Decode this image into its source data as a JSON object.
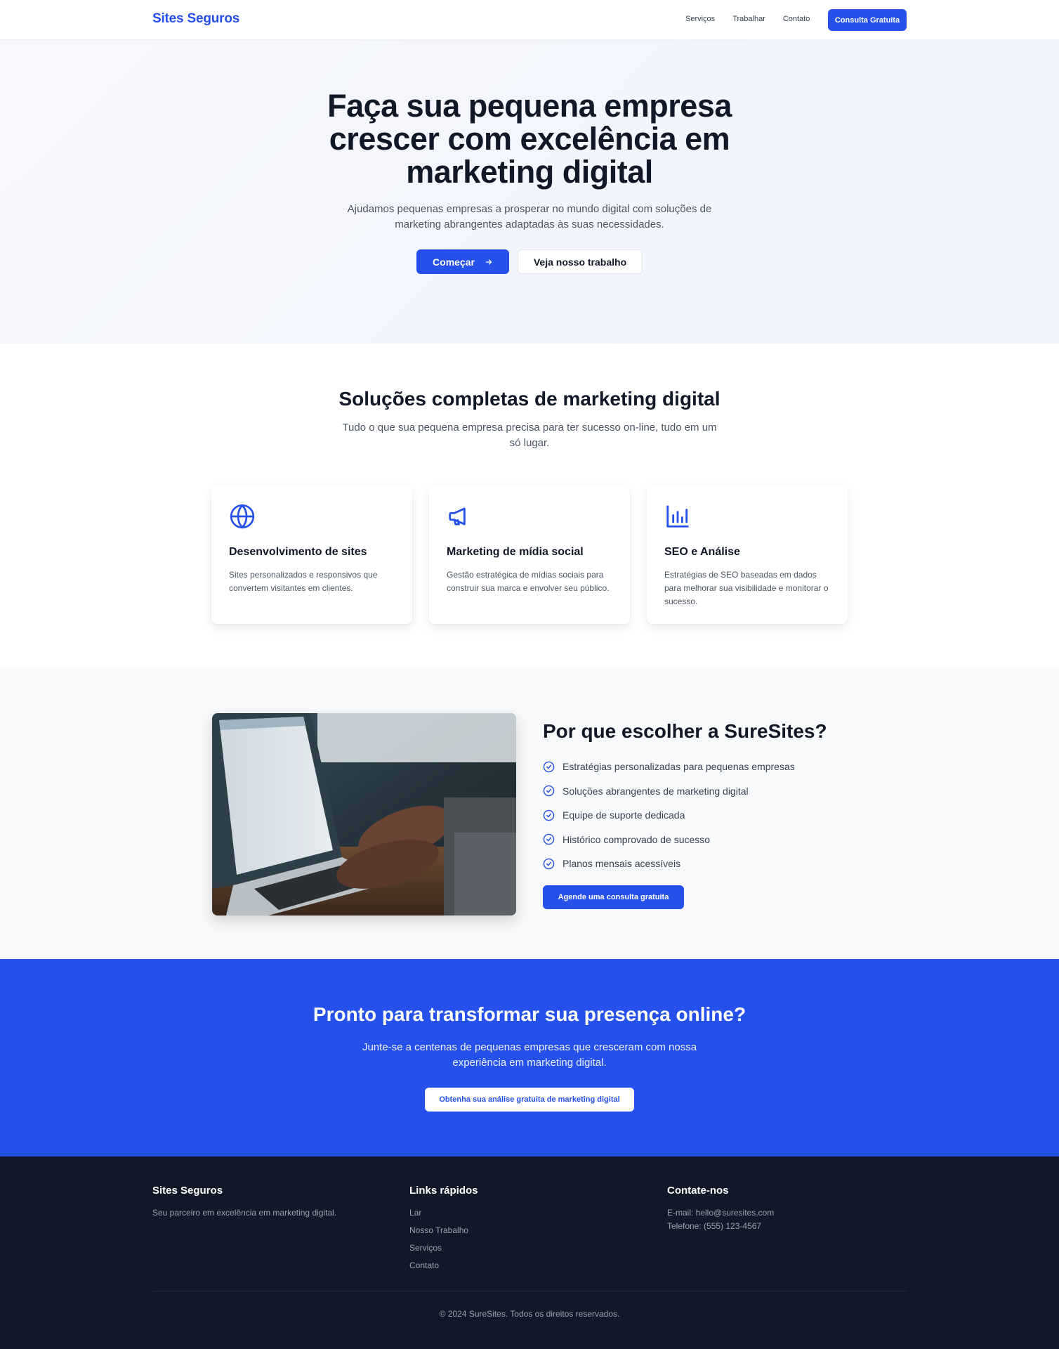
{
  "header": {
    "brand": "Sites Seguros",
    "nav": [
      "Serviços",
      "Trabalhar",
      "Contato"
    ],
    "cta": "Consulta Gratuita"
  },
  "hero": {
    "title": "Faça sua pequena empresa crescer com excelência em marketing digital",
    "subtitle": "Ajudamos pequenas empresas a prosperar no mundo digital com soluções de marketing abrangentes adaptadas às suas necessidades.",
    "primary_button": "Começar",
    "secondary_button": "Veja nosso trabalho"
  },
  "services": {
    "title": "Soluções completas de marketing digital",
    "subtitle": "Tudo o que sua pequena empresa precisa para ter sucesso on-line, tudo em um só lugar.",
    "cards": [
      {
        "icon": "globe-icon",
        "title": "Desenvolvimento de sites",
        "text": "Sites personalizados e responsivos que convertem visitantes em clientes."
      },
      {
        "icon": "megaphone-icon",
        "title": "Marketing de mídia social",
        "text": "Gestão estratégica de mídias sociais para construir sua marca e envolver seu público."
      },
      {
        "icon": "bar-chart-icon",
        "title": "SEO e Análise",
        "text": "Estratégias de SEO baseadas em dados para melhorar sua visibilidade e monitorar o sucesso."
      }
    ]
  },
  "why": {
    "title": "Por que escolher a SureSites?",
    "items": [
      "Estratégias personalizadas para pequenas empresas",
      "Soluções abrangentes de marketing digital",
      "Equipe de suporte dedicada",
      "Histórico comprovado de sucesso",
      "Planos mensais acessíveis"
    ],
    "button": "Agende uma consulta gratuita"
  },
  "cta": {
    "title": "Pronto para transformar sua presença online?",
    "subtitle": "Junte-se a centenas de pequenas empresas que cresceram com nossa experiência em marketing digital.",
    "button": "Obtenha sua análise gratuita de marketing digital"
  },
  "footer": {
    "brand": "Sites Seguros",
    "tagline": "Seu parceiro em excelência em marketing digital.",
    "links_title": "Links rápidos",
    "links": [
      "Lar",
      "Nosso Trabalho",
      "Serviços",
      "Contato"
    ],
    "contact_title": "Contate-nos",
    "email": "E-mail: hello@suresites.com",
    "phone": "Telefone: (555) 123-4567",
    "copyright": "© 2024 SureSites. Todos os direitos reservados."
  },
  "colors": {
    "accent": "#2550ea",
    "dark": "#111827",
    "muted": "#4b5563"
  }
}
